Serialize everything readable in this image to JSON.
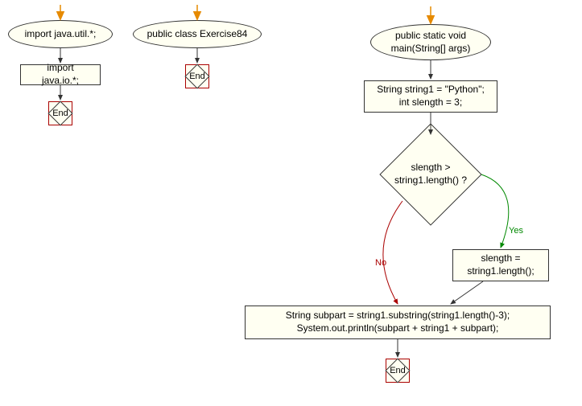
{
  "flow1": {
    "start_ellipse": "import java.util.*;",
    "rect1": "import java.io.*;",
    "end": "End"
  },
  "flow2": {
    "start_ellipse": "public class Exercise84",
    "end": "End"
  },
  "flow3": {
    "start_ellipse": "public static void\nmain(String[] args)",
    "rect1": "String string1 = \"Python\";\nint slength = 3;",
    "decision": "slength >\nstring1.length() ?",
    "yes_label": "Yes",
    "no_label": "No",
    "rect_yes": "slength =\nstring1.length();",
    "rect_final": "String subpart = string1.substring(string1.length()-3);\nSystem.out.println(subpart + string1 + subpart);",
    "end": "End"
  },
  "chart_data": {
    "type": "flowchart",
    "subgraphs": [
      {
        "id": "A",
        "nodes": [
          {
            "id": "a1",
            "type": "start",
            "label": "import java.util.*;"
          },
          {
            "id": "a2",
            "type": "process",
            "label": "import java.io.*;"
          },
          {
            "id": "a3",
            "type": "end",
            "label": "End"
          }
        ],
        "edges": [
          {
            "from": "entry",
            "to": "a1"
          },
          {
            "from": "a1",
            "to": "a2"
          },
          {
            "from": "a2",
            "to": "a3"
          }
        ]
      },
      {
        "id": "B",
        "nodes": [
          {
            "id": "b1",
            "type": "start",
            "label": "public class Exercise84"
          },
          {
            "id": "b2",
            "type": "end",
            "label": "End"
          }
        ],
        "edges": [
          {
            "from": "entry",
            "to": "b1"
          },
          {
            "from": "b1",
            "to": "b2"
          }
        ]
      },
      {
        "id": "C",
        "nodes": [
          {
            "id": "c1",
            "type": "start",
            "label": "public static void main(String[] args)"
          },
          {
            "id": "c2",
            "type": "process",
            "label": "String string1 = \"Python\"; int slength = 3;"
          },
          {
            "id": "c3",
            "type": "decision",
            "label": "slength > string1.length() ?"
          },
          {
            "id": "c4",
            "type": "process",
            "label": "slength = string1.length();"
          },
          {
            "id": "c5",
            "type": "process",
            "label": "String subpart = string1.substring(string1.length()-3); System.out.println(subpart + string1 + subpart);"
          },
          {
            "id": "c6",
            "type": "end",
            "label": "End"
          }
        ],
        "edges": [
          {
            "from": "entry",
            "to": "c1"
          },
          {
            "from": "c1",
            "to": "c2"
          },
          {
            "from": "c2",
            "to": "c3"
          },
          {
            "from": "c3",
            "to": "c4",
            "label": "Yes"
          },
          {
            "from": "c3",
            "to": "c5",
            "label": "No"
          },
          {
            "from": "c4",
            "to": "c5"
          },
          {
            "from": "c5",
            "to": "c6"
          }
        ]
      }
    ]
  }
}
